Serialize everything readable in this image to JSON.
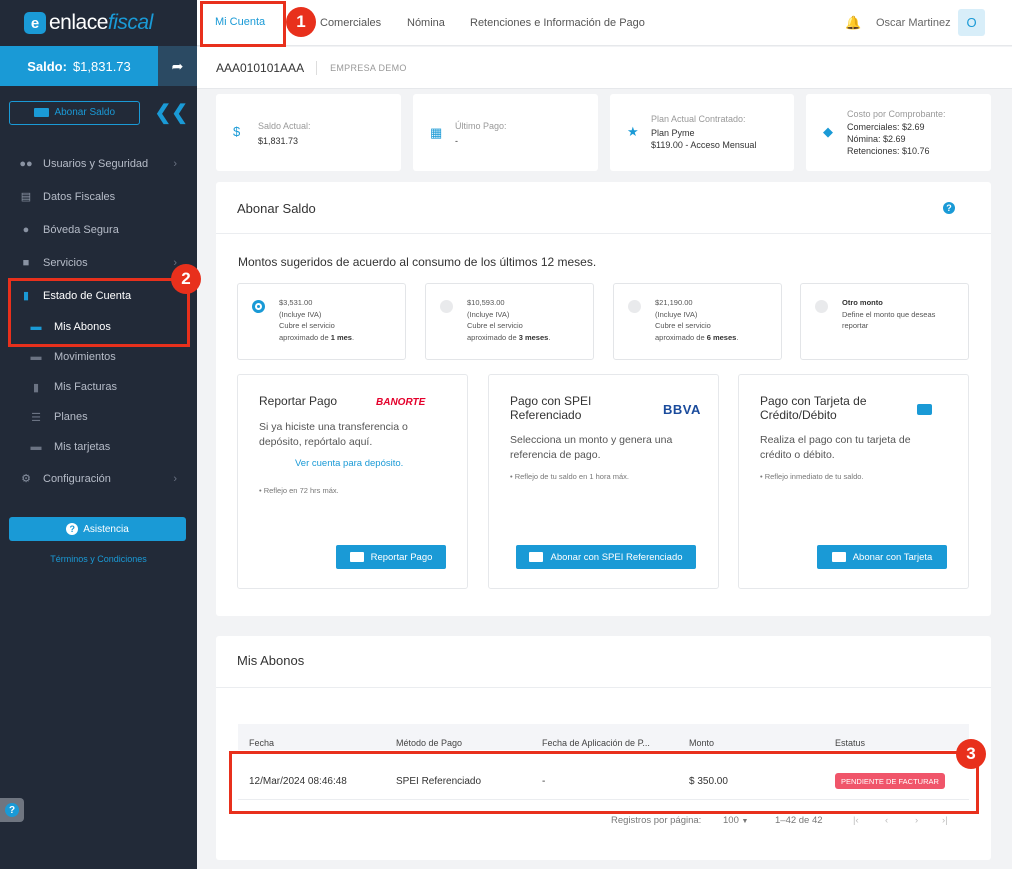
{
  "sidebar": {
    "logo_part1": "enlace",
    "logo_part2": "fiscal",
    "logo_badge": "e",
    "saldo_label": "Saldo:",
    "saldo_value": "$1,831.73",
    "abonar_label": "Abonar Saldo",
    "nav": [
      {
        "label": "Usuarios y Seguridad",
        "icon": "users-icon"
      },
      {
        "label": "Datos Fiscales",
        "icon": "bank-icon"
      },
      {
        "label": "Bóveda Segura",
        "icon": "vault-icon"
      },
      {
        "label": "Servicios",
        "icon": "puzzle-icon"
      },
      {
        "label": "Estado de Cuenta",
        "icon": "document-icon"
      }
    ],
    "sub": [
      {
        "label": "Mis Abonos"
      },
      {
        "label": "Movimientos"
      },
      {
        "label": "Mis Facturas"
      },
      {
        "label": "Planes"
      },
      {
        "label": "Mis tarjetas"
      }
    ],
    "config_label": "Configuración",
    "asistencia_label": "Asistencia",
    "terms_label": "Términos y Condiciones"
  },
  "topbar": {
    "tabs": [
      "Mi Cuenta",
      "Comerciales",
      "Nómina",
      "Retenciones e Información de Pago"
    ],
    "user_name": "Oscar Martinez",
    "avatar_letter": "O"
  },
  "subbar": {
    "rfc": "AAA010101AAA",
    "empresa": "EMPRESA DEMO"
  },
  "stats": {
    "saldo_label": "Saldo Actual:",
    "saldo_value": "$1,831.73",
    "ultimo_label": "Último Pago:",
    "ultimo_value": "-",
    "plan_label": "Plan Actual Contratado:",
    "plan_name": "Plan Pyme",
    "plan_price": "$119.00 - Acceso Mensual",
    "costo_label": "Costo por Comprobante:",
    "costo_1": "Comerciales: $2.69",
    "costo_2": "Nómina: $2.69",
    "costo_3": "Retenciones: $10.76"
  },
  "abonar": {
    "title": "Abonar Saldo",
    "montos_title": "Montos sugeridos de acuerdo al consumo de los últimos 12 meses.",
    "options": [
      {
        "amount": "$3,531.00",
        "iva": "(Incluye IVA)",
        "desc": "Cubre el servicio",
        "period_pre": "aproximado de ",
        "period": "1 mes",
        "selected": true
      },
      {
        "amount": "$10,593.00",
        "iva": "(Incluye IVA)",
        "desc": "Cubre el servicio",
        "period_pre": "aproximado de ",
        "period": "3 meses",
        "selected": false
      },
      {
        "amount": "$21,190.00",
        "iva": "(Incluye IVA)",
        "desc": "Cubre el servicio",
        "period_pre": "aproximado de ",
        "period": "6 meses",
        "selected": false
      }
    ],
    "otro_title": "Otro monto",
    "otro_desc1": "Define el monto que deseas",
    "otro_desc2": "reportar",
    "cards": {
      "reportar": {
        "title": "Reportar Pago",
        "brand": "BANORTE",
        "desc1": "Si ya hiciste una transferencia o",
        "desc2": "depósito, repórtalo aquí.",
        "link": "Ver cuenta para depósito.",
        "note": "•   Reflejo en 72 hrs máx.",
        "button": "Reportar Pago"
      },
      "spei": {
        "title1": "Pago con SPEI",
        "title2": "Referenciado",
        "brand": "BBVA",
        "desc1": "Selecciona un monto y genera una",
        "desc2": "referencia de pago.",
        "note": "•   Reflejo de tu saldo en 1 hora máx.",
        "button": "Abonar con SPEI Referenciado"
      },
      "tarjeta": {
        "title1": "Pago con Tarjeta de",
        "title2": "Crédito/Débito",
        "desc1": "Realiza el pago con tu tarjeta de",
        "desc2": "crédito o débito.",
        "note": "•   Reflejo inmediato de tu saldo.",
        "button": "Abonar con Tarjeta"
      }
    }
  },
  "abonos": {
    "title": "Mis Abonos",
    "columns": [
      "Fecha",
      "Método de Pago",
      "Fecha de Aplicación de P...",
      "Monto",
      "Estatus"
    ],
    "rows": [
      {
        "fecha": "12/Mar/2024 08:46:48",
        "metodo": "SPEI Referenciado",
        "aplicacion": "-",
        "monto": "$ 350.00",
        "estatus": "PENDIENTE DE FACTURAR"
      }
    ],
    "pag_label": "Registros por página:",
    "pag_size": "100",
    "pag_range": "1–42 de 42"
  },
  "annotations": [
    "1",
    "2",
    "3"
  ],
  "colors": {
    "accent": "#1a9ad6",
    "sidebar": "#222a38",
    "annotation": "#e8301c",
    "badge": "#f0556a"
  }
}
